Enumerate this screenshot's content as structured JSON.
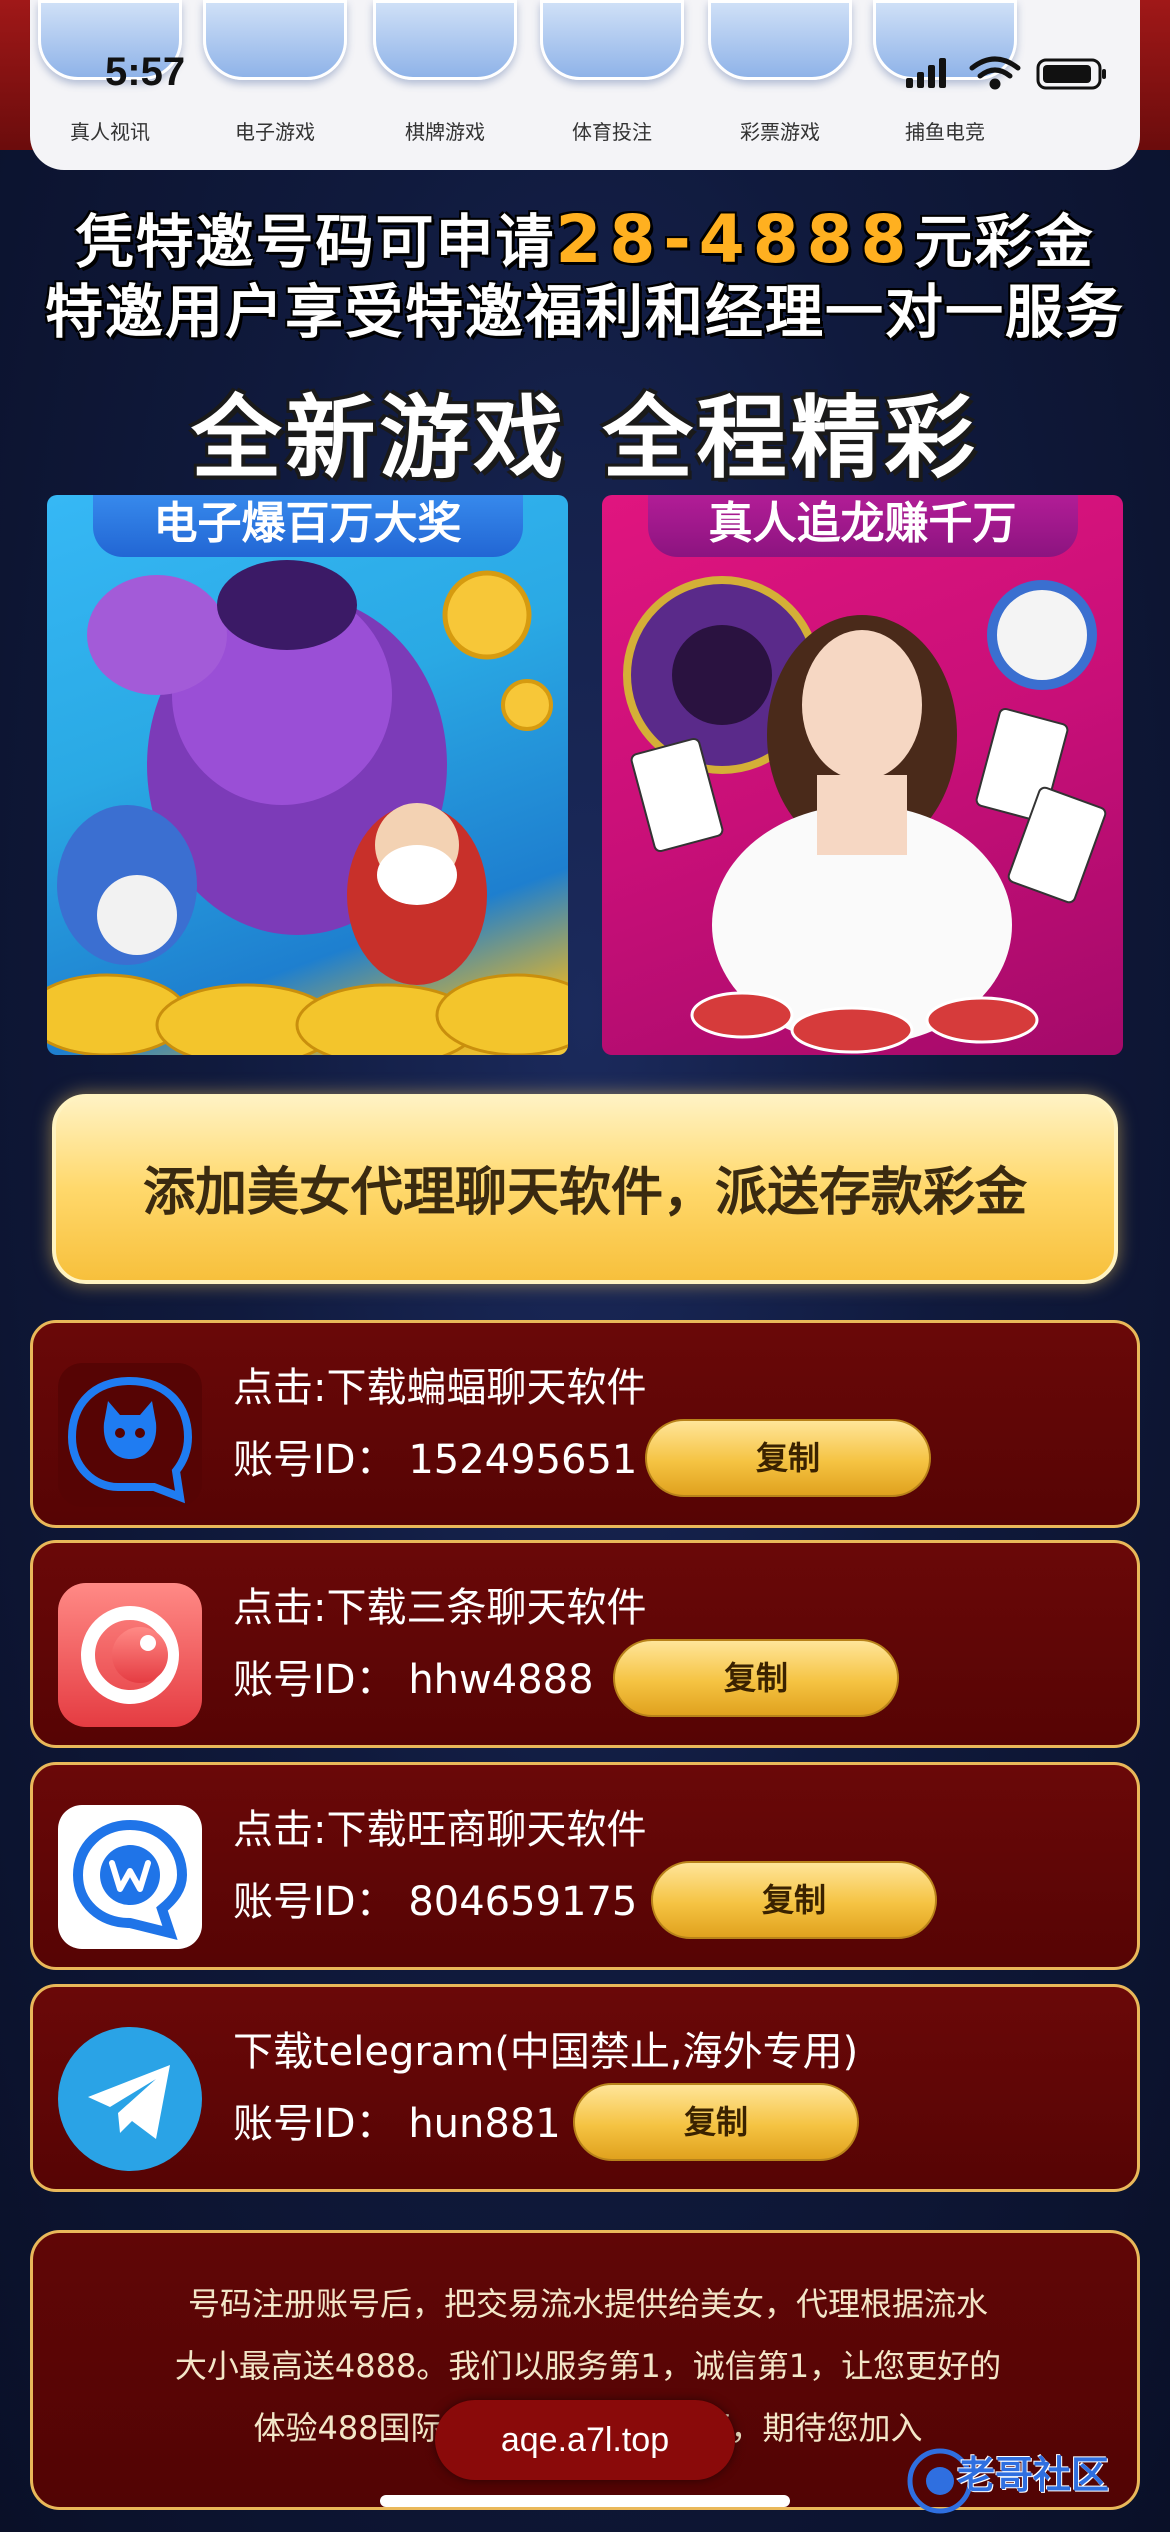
{
  "status_bar": {
    "time": "5:57"
  },
  "nav": {
    "items": [
      {
        "label": "真人视讯"
      },
      {
        "label": "电子游戏"
      },
      {
        "label": "棋牌游戏"
      },
      {
        "label": "体育投注"
      },
      {
        "label": "彩票游戏"
      },
      {
        "label": "捕鱼电竞"
      }
    ]
  },
  "promo": {
    "line1_prefix": "凭特邀号码可申请",
    "line1_amount": "28-4888",
    "line1_suffix": "元彩金",
    "line2": "特邀用户享受特邀福利和经理一对一服务"
  },
  "headline": "全新游戏 全程精彩",
  "panels": {
    "slots": {
      "label": "电子爆百万大奖"
    },
    "live": {
      "label": "真人追龙赚千万"
    }
  },
  "cta": {
    "label": "添加美女代理聊天软件，派送存款彩金"
  },
  "apps": [
    {
      "title": "点击:下载蝙蝠聊天软件",
      "account_label": "账号ID：",
      "account_id": "152495651",
      "copy_label": "复制",
      "icon": "bat-chat-icon"
    },
    {
      "title": "点击:下载三条聊天软件",
      "account_label": "账号ID：",
      "account_id": "hhw4888",
      "copy_label": "复制",
      "icon": "santiao-chat-icon"
    },
    {
      "title": "点击:下载旺商聊天软件",
      "account_label": "账号ID：",
      "account_id": "804659175",
      "copy_label": "复制",
      "icon": "wangshang-chat-icon"
    },
    {
      "title": "下载telegram(中国禁止,海外专用)",
      "account_label": "账号ID：",
      "account_id": "hun881",
      "copy_label": "复制",
      "icon": "telegram-icon"
    }
  ],
  "info": {
    "line1": "号码注册账号后，把交易流水提供给美女，代理根据流水",
    "line2": "大小最高送4888。我们以服务第1，诚信第1，让您更好的",
    "line3": "体验488国际。我们期待您在下面，期待您加入"
  },
  "browser": {
    "url": "aqe.a7l.top"
  },
  "watermark": {
    "text": "老哥社区"
  },
  "colors": {
    "card_bg": "#5a0505",
    "card_border": "#e9b85a",
    "gold": "#ffb020",
    "page_bg": "#101a3d"
  }
}
